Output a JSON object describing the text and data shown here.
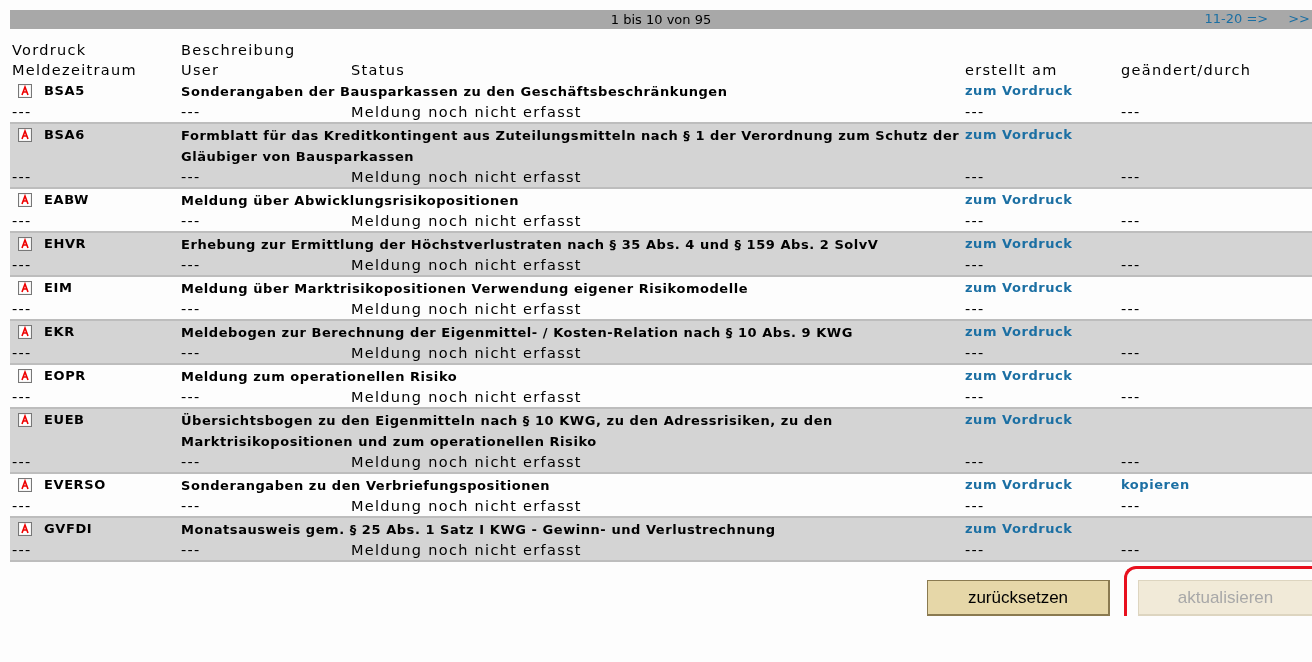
{
  "pager": {
    "range": "1 bis 10 von 95",
    "next": "11-20 =>",
    "last": ">>"
  },
  "columns": {
    "vordruck": "Vordruck",
    "beschreibung": "Beschreibung",
    "meldezeitraum": "Meldezeitraum",
    "user": "User",
    "status": "Status",
    "erstellt": "erstellt am",
    "geaendert": "geändert/durch"
  },
  "rows": [
    {
      "code": "BSA5",
      "description": "Sonderangaben der Bausparkassen zu den Geschäftsbeschränkungen",
      "link": "zum Vordruck",
      "action": "",
      "period": "---",
      "user": "---",
      "status": "Meldung noch nicht erfasst",
      "created": "---",
      "changed": "---"
    },
    {
      "code": "BSA6",
      "description": "Formblatt für das Kreditkontingent aus Zuteilungsmitteln nach § 1 der Verordnung zum Schutz der Gläubiger von Bausparkassen",
      "link": "zum Vordruck",
      "action": "",
      "period": "---",
      "user": "---",
      "status": "Meldung noch nicht erfasst",
      "created": "---",
      "changed": "---"
    },
    {
      "code": "EABW",
      "description": "Meldung über Abwicklungsrisikopositionen",
      "link": "zum Vordruck",
      "action": "",
      "period": "---",
      "user": "---",
      "status": "Meldung noch nicht erfasst",
      "created": "---",
      "changed": "---"
    },
    {
      "code": "EHVR",
      "description": "Erhebung zur Ermittlung der Höchstverlustraten nach § 35 Abs. 4 und § 159 Abs. 2 SolvV",
      "link": "zum Vordruck",
      "action": "",
      "period": "---",
      "user": "---",
      "status": "Meldung noch nicht erfasst",
      "created": "---",
      "changed": "---"
    },
    {
      "code": "EIM",
      "description": "Meldung über Marktrisikopositionen Verwendung eigener Risikomodelle",
      "link": "zum Vordruck",
      "action": "",
      "period": "---",
      "user": "---",
      "status": "Meldung noch nicht erfasst",
      "created": "---",
      "changed": "---"
    },
    {
      "code": "EKR",
      "description": "Meldebogen zur Berechnung der Eigenmittel- / Kosten-Relation nach § 10 Abs. 9 KWG",
      "link": "zum Vordruck",
      "action": "",
      "period": "---",
      "user": "---",
      "status": "Meldung noch nicht erfasst",
      "created": "---",
      "changed": "---"
    },
    {
      "code": "EOPR",
      "description": "Meldung zum operationellen Risiko",
      "link": "zum Vordruck",
      "action": "",
      "period": "---",
      "user": "---",
      "status": "Meldung noch nicht erfasst",
      "created": "---",
      "changed": "---"
    },
    {
      "code": "EUEB",
      "description": "Übersichtsbogen zu den Eigenmitteln nach § 10 KWG, zu den Adressrisiken, zu den Marktrisikopositionen und zum operationellen Risiko",
      "link": "zum Vordruck",
      "action": "",
      "period": "---",
      "user": "---",
      "status": "Meldung noch nicht erfasst",
      "created": "---",
      "changed": "---"
    },
    {
      "code": "EVERSO",
      "description": "Sonderangaben zu den Verbriefungspositionen",
      "link": "zum Vordruck",
      "action": "kopieren",
      "period": "---",
      "user": "---",
      "status": "Meldung noch nicht erfasst",
      "created": "---",
      "changed": "---"
    },
    {
      "code": "GVFDI",
      "description": "Monatsausweis gem. § 25 Abs. 1 Satz I KWG - Gewinn- und Verlustrechnung",
      "link": "zum Vordruck",
      "action": "",
      "period": "---",
      "user": "---",
      "status": "Meldung noch nicht erfasst",
      "created": "---",
      "changed": "---"
    }
  ],
  "buttons": [
    {
      "label": "zurücksetzen",
      "disabled": false,
      "highlighted": false
    },
    {
      "label": "aktualisieren",
      "disabled": true,
      "highlighted": true
    }
  ]
}
